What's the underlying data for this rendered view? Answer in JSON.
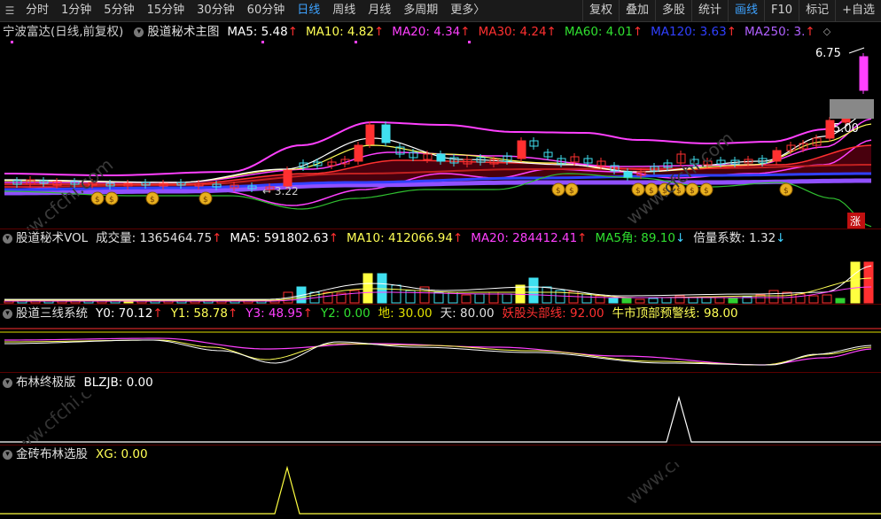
{
  "toolbar": {
    "periods": [
      "分时",
      "1分钟",
      "5分钟",
      "15分钟",
      "30分钟",
      "60分钟",
      "日线",
      "周线",
      "月线",
      "多周期",
      "更多〉"
    ],
    "active_period": "日线",
    "right_buttons": [
      "复权",
      "叠加",
      "多股",
      "统计",
      "画线",
      "F10",
      "标记",
      "+自选"
    ],
    "active_right": "画线"
  },
  "main_chart": {
    "stock_name": "宁波富达(日线,前复权)",
    "indicator_name": "股道秘术主图",
    "ma": [
      {
        "label": "MA5: 5.48",
        "color": "#ffffff"
      },
      {
        "label": "MA10: 4.82",
        "color": "#ffff55"
      },
      {
        "label": "MA20: 4.34",
        "color": "#ff40ff"
      },
      {
        "label": "MA30: 4.24",
        "color": "#ff3030"
      },
      {
        "label": "MA60: 4.01",
        "color": "#30e030"
      },
      {
        "label": "MA120: 3.63",
        "color": "#3040ff"
      },
      {
        "label": "MA250: 3.",
        "color": "#b060ff"
      }
    ],
    "high_label": "6.75",
    "price_5_label": "5.00",
    "low_label": "3.22",
    "limit_up_badge": "涨"
  },
  "vol_panel": {
    "name": "股道秘术VOL",
    "items": [
      {
        "label": "成交量: 1365464.75",
        "color": "#e0e0e0",
        "arrow": "up"
      },
      {
        "label": "MA5: 591802.63",
        "color": "#ffffff",
        "arrow": "up"
      },
      {
        "label": "MA10: 412066.94",
        "color": "#ffff55",
        "arrow": "up"
      },
      {
        "label": "MA20: 284412.41",
        "color": "#ff40ff",
        "arrow": "up"
      },
      {
        "label": "MA5角: 89.10",
        "color": "#30e030",
        "arrow": "down"
      },
      {
        "label": "倍量系数: 1.32",
        "color": "#e0e0e0",
        "arrow": "down"
      }
    ]
  },
  "three_line_panel": {
    "name": "股道三线系统",
    "items": [
      {
        "label": "Y0: 70.12",
        "color": "#ffffff",
        "arrow": "up"
      },
      {
        "label": "Y1: 58.78",
        "color": "#ffff55",
        "arrow": "up"
      },
      {
        "label": "Y3: 48.95",
        "color": "#ff40ff",
        "arrow": "up"
      },
      {
        "label": "Y2: 0.00",
        "color": "#30e030",
        "arrow": ""
      },
      {
        "label": "地: 30.00",
        "color": "#e0e000",
        "arrow": ""
      },
      {
        "label": "天: 80.00",
        "color": "#e0e0e0",
        "arrow": ""
      },
      {
        "label": "妖股头部线: 92.00",
        "color": "#ff3030",
        "arrow": ""
      },
      {
        "label": "牛市顶部预警线: 98.00",
        "color": "#ffff55",
        "arrow": ""
      }
    ]
  },
  "boll_panel": {
    "name": "布林终极版",
    "items": [
      {
        "label": "BLZJB: 0.00",
        "color": "#ffffff"
      }
    ]
  },
  "gold_panel": {
    "name": "金砖布林选股",
    "items": [
      {
        "label": "XG: 0.00",
        "color": "#ffff55"
      }
    ]
  },
  "watermark": "www.cfchi.com"
}
